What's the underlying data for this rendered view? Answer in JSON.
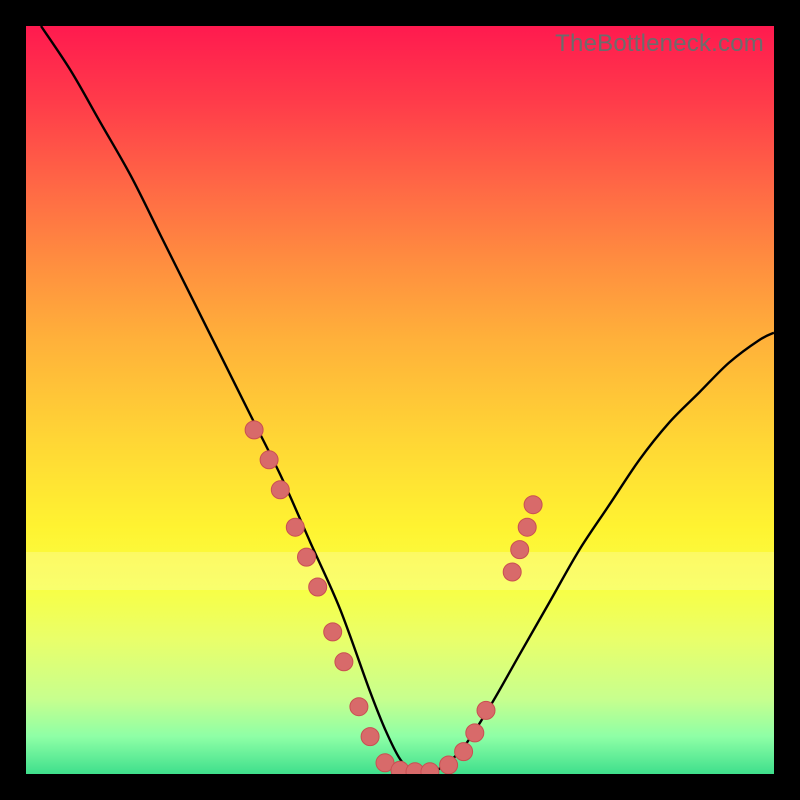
{
  "watermark": "TheBottleneck.com",
  "colors": {
    "curve_stroke": "#000000",
    "dot_fill": "#d86a6a",
    "dot_stroke": "#c94f52"
  },
  "chart_data": {
    "type": "line",
    "title": "",
    "xlabel": "",
    "ylabel": "",
    "xlim": [
      0,
      100
    ],
    "ylim": [
      0,
      100
    ],
    "series": [
      {
        "name": "bottleneck-curve",
        "x": [
          2,
          6,
          10,
          14,
          18,
          22,
          26,
          30,
          34,
          38,
          42,
          46,
          48,
          50,
          52,
          54,
          58,
          62,
          66,
          70,
          74,
          78,
          82,
          86,
          90,
          94,
          98,
          100
        ],
        "y": [
          100,
          94,
          87,
          80,
          72,
          64,
          56,
          48,
          40,
          31,
          22,
          11,
          6,
          2,
          0,
          0,
          3,
          9,
          16,
          23,
          30,
          36,
          42,
          47,
          51,
          55,
          58,
          59
        ]
      }
    ],
    "scatter_points": {
      "name": "data-dots",
      "points": [
        {
          "x": 30.5,
          "y": 46
        },
        {
          "x": 32.5,
          "y": 42
        },
        {
          "x": 34.0,
          "y": 38
        },
        {
          "x": 36.0,
          "y": 33
        },
        {
          "x": 37.5,
          "y": 29
        },
        {
          "x": 39.0,
          "y": 25
        },
        {
          "x": 41.0,
          "y": 19
        },
        {
          "x": 42.5,
          "y": 15
        },
        {
          "x": 44.5,
          "y": 9
        },
        {
          "x": 46.0,
          "y": 5
        },
        {
          "x": 48.0,
          "y": 1.5
        },
        {
          "x": 50.0,
          "y": 0.5
        },
        {
          "x": 52.0,
          "y": 0.3
        },
        {
          "x": 54.0,
          "y": 0.3
        },
        {
          "x": 56.5,
          "y": 1.2
        },
        {
          "x": 58.5,
          "y": 3.0
        },
        {
          "x": 60.0,
          "y": 5.5
        },
        {
          "x": 61.5,
          "y": 8.5
        },
        {
          "x": 65.0,
          "y": 27
        },
        {
          "x": 66.0,
          "y": 30
        },
        {
          "x": 67.0,
          "y": 33
        },
        {
          "x": 67.8,
          "y": 36
        }
      ]
    },
    "annotations": []
  }
}
